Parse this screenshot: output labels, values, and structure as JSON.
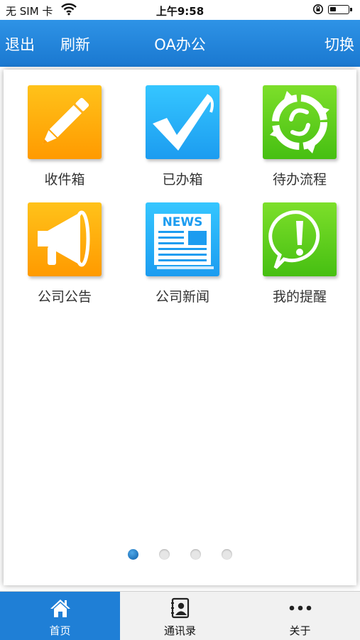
{
  "status_bar": {
    "carrier": "无 SIM 卡",
    "time": "上午9:58"
  },
  "navbar": {
    "left_label": "退出",
    "refresh_label": "刷新",
    "title": "OA办公",
    "right_label": "切换"
  },
  "tiles": [
    {
      "label": "收件箱",
      "icon": "pencil-icon",
      "color": "#ffa500"
    },
    {
      "label": "已办箱",
      "icon": "checkmark-icon",
      "color": "#26aef5"
    },
    {
      "label": "待办流程",
      "icon": "recycle-arrows-icon",
      "color": "#5ccf1c"
    },
    {
      "label": "公司公告",
      "icon": "megaphone-icon",
      "color": "#ffa500"
    },
    {
      "label": "公司新闻",
      "icon": "newspaper-icon",
      "color": "#26aef5",
      "icon_text": "NEWS"
    },
    {
      "label": "我的提醒",
      "icon": "exclamation-icon",
      "color": "#5ccf1c"
    }
  ],
  "pagination": {
    "pages": 4,
    "current": 1
  },
  "tabbar": {
    "items": [
      {
        "label": "首页",
        "icon": "home-icon",
        "active": true
      },
      {
        "label": "通讯录",
        "icon": "contacts-icon",
        "active": false
      },
      {
        "label": "关于",
        "icon": "more-dots-icon",
        "active": false
      }
    ]
  }
}
